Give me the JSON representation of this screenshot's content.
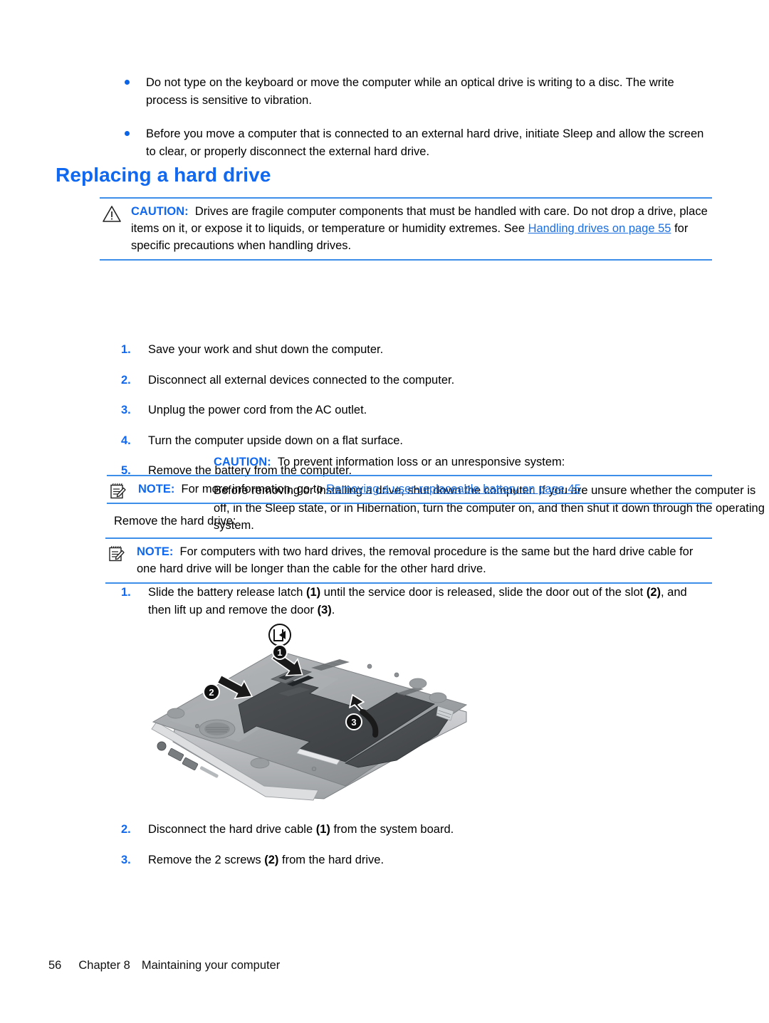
{
  "bullets": [
    {
      "text": "Do not type on the keyboard or move the computer while an optical drive is writing to a disc. The write process is sensitive to vibration."
    },
    {
      "text": "Before you move a computer that is connected to an external hard drive, initiate Sleep and allow the screen to clear, or properly disconnect the external hard drive."
    }
  ],
  "heading": "Replacing a hard drive",
  "caution_handling": {
    "label": "CAUTION:",
    "icon": "warning-triangle-icon",
    "text_before_link": "Drives are fragile computer components that must be handled with care. Do not drop a drive, place items on it, or expose it to liquids, or temperature or humidity extremes. See ",
    "link": "Handling drives on page 55",
    "text_after_link": " for specific precautions when handling drives."
  },
  "caution_prevent": {
    "label": "CAUTION:",
    "text": "To prevent information loss or an unresponsive system:"
  },
  "caution_paragraph": "Before removing or installing a drive, shut down the computer. If you are unsure whether the computer is off, in the Sleep state, or in Hibernation, turn the computer on, and then shut it down through the operating system.",
  "steps_shutdown": [
    {
      "num": "1.",
      "text": "Save your work and shut down the computer."
    },
    {
      "num": "2.",
      "text": "Disconnect all external devices connected to the computer."
    },
    {
      "num": "3.",
      "text": "Unplug the power cord from the AC outlet."
    },
    {
      "num": "4.",
      "text": "Turn the computer upside down on a flat surface."
    },
    {
      "num": "5.",
      "text": "Remove the battery from the computer."
    }
  ],
  "note_battery": {
    "label": "NOTE:",
    "icon": "notepad-pencil-icon",
    "text_before_link": "For more information, go to ",
    "link": "Removing a user-replaceable battery on page 45",
    "text_after_link": "."
  },
  "remove_hard_drive_line": "Remove the hard drive:",
  "note_two_drives": {
    "label": "NOTE:",
    "icon": "notepad-pencil-icon",
    "text": "For computers with two hard drives, the removal procedure is the same but the hard drive cable for one hard drive will be longer than the cable for the other hard drive."
  },
  "steps_remove": [
    {
      "num": "1.",
      "parts": [
        {
          "t": "Slide the battery release latch ",
          "b": false
        },
        {
          "t": "(1)",
          "b": true
        },
        {
          "t": " until the service door is released, slide the door out of the slot ",
          "b": false
        },
        {
          "t": "(2)",
          "b": true
        },
        {
          "t": ", and then lift up and remove the door ",
          "b": false
        },
        {
          "t": "(3)",
          "b": true
        },
        {
          "t": ".",
          "b": false
        }
      ]
    }
  ],
  "figure": {
    "name": "laptop-bottom-service-door-illustration",
    "callouts": [
      "1",
      "2",
      "3"
    ],
    "latch_icon": "battery-release-latch-icon"
  },
  "steps_after": [
    {
      "num": "2.",
      "parts": [
        {
          "t": "Disconnect the hard drive cable ",
          "b": false
        },
        {
          "t": "(1)",
          "b": true
        },
        {
          "t": " from the system board.",
          "b": false
        }
      ]
    },
    {
      "num": "3.",
      "parts": [
        {
          "t": "Remove the 2 screws ",
          "b": false
        },
        {
          "t": "(2)",
          "b": true
        },
        {
          "t": " from the hard drive.",
          "b": false
        }
      ]
    }
  ],
  "footer": {
    "page_number": "56",
    "chapter": "Chapter 8",
    "title": "Maintaining your computer"
  },
  "colors": {
    "accent_blue": "#0f68ef",
    "rule_blue": "#3d8ee8",
    "link_blue": "#1a6ee0",
    "text_black": "#000000"
  }
}
